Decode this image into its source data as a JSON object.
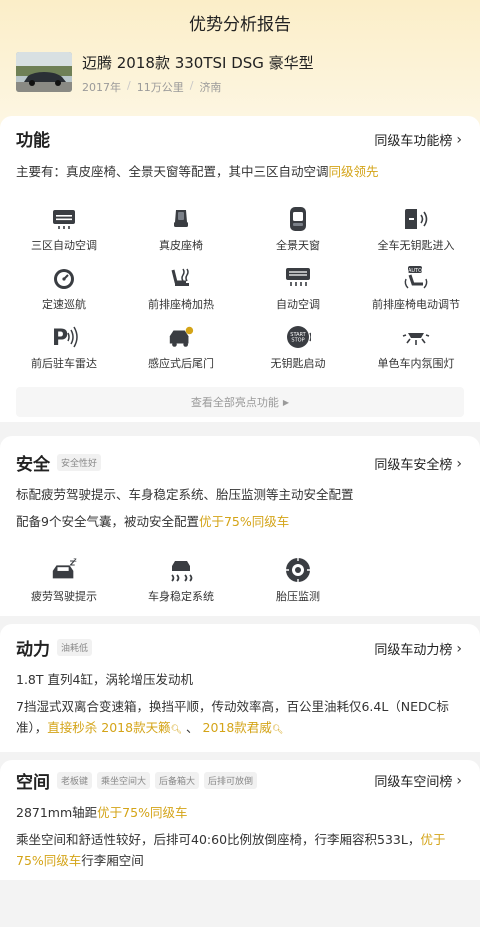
{
  "page_title": "优势分析报告",
  "car": {
    "name": "迈腾 2018款 330TSI DSG 豪华型",
    "year": "2017年",
    "mileage": "11万公里",
    "city": "济南"
  },
  "function": {
    "title": "功能",
    "rank_label": "同级车功能榜",
    "summary_prefix": "主要有：真皮座椅、全景天窗等配置，其中三区自动空调",
    "summary_highlight": "同级领先",
    "features": [
      {
        "label": "三区自动空调",
        "icon": "ac-vent-icon"
      },
      {
        "label": "真皮座椅",
        "icon": "leather-seat-icon"
      },
      {
        "label": "全景天窗",
        "icon": "panoramic-sunroof-icon"
      },
      {
        "label": "全车无钥匙进入",
        "icon": "keyless-entry-icon"
      },
      {
        "label": "定速巡航",
        "icon": "cruise-control-icon"
      },
      {
        "label": "前排座椅加热",
        "icon": "seat-heating-icon"
      },
      {
        "label": "自动空调",
        "icon": "auto-ac-icon"
      },
      {
        "label": "前排座椅电动调节",
        "icon": "power-seat-icon"
      },
      {
        "label": "前后驻车雷达",
        "icon": "parking-radar-icon"
      },
      {
        "label": "感应式后尾门",
        "icon": "smart-tailgate-icon"
      },
      {
        "label": "无钥匙启动",
        "icon": "keyless-start-icon"
      },
      {
        "label": "单色车内氛围灯",
        "icon": "ambient-light-icon"
      }
    ],
    "more_label": "查看全部亮点功能"
  },
  "safety": {
    "title": "安全",
    "tag": "安全性好",
    "rank_label": "同级车安全榜",
    "line1": "标配疲劳驾驶提示、车身稳定系统、胎压监测等主动安全配置",
    "line2_prefix": "配备9个安全气囊，被动安全配置",
    "line2_highlight": "优于75%同级车",
    "features": [
      {
        "label": "疲劳驾驶提示",
        "icon": "fatigue-alert-icon"
      },
      {
        "label": "车身稳定系统",
        "icon": "stability-control-icon"
      },
      {
        "label": "胎压监测",
        "icon": "tire-pressure-icon"
      }
    ]
  },
  "power": {
    "title": "动力",
    "tag": "油耗低",
    "rank_label": "同级车动力榜",
    "engine": "1.8T 直列4缸，涡轮增压发动机",
    "desc": "7挡湿式双离合变速箱，换挡平顺，传动效率高，百公里油耗仅6.4L（NEDC标准），",
    "compare_text": "直接秒杀",
    "compare_car1": "2018款天籁",
    "separator": "、",
    "compare_car2": "2018款君威"
  },
  "space": {
    "title": "空间",
    "tags": [
      "老板键",
      "乘坐空间大",
      "后备箱大",
      "后排可放倒"
    ],
    "rank_label": "同级车空间榜",
    "wheelbase_prefix": "2871mm轴距",
    "wheelbase_highlight": "优于75%同级车",
    "desc_prefix": "乘坐空间和舒适性较好，后排可40:60比例放倒座椅，行李厢容积533L，",
    "desc_highlight": "优于75%同级车",
    "desc_suffix": "行李厢空间"
  },
  "colors": {
    "accent": "#d4a418",
    "header_bg": "#fbeec8"
  }
}
